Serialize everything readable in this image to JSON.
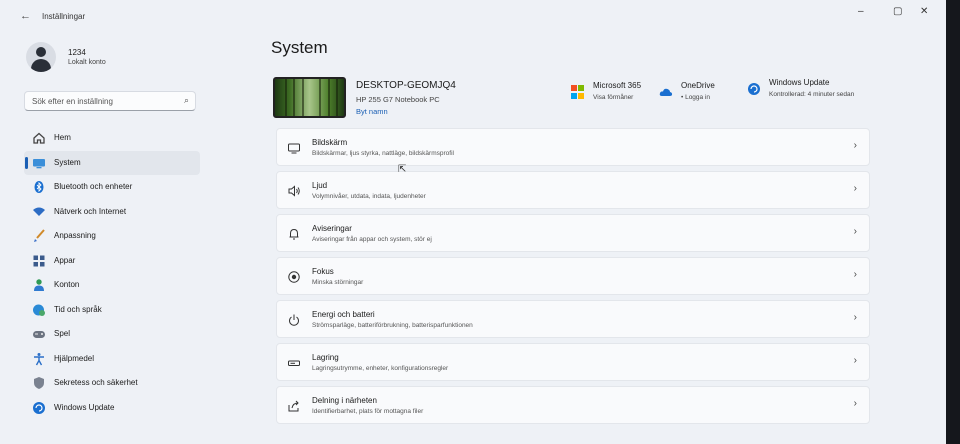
{
  "window": {
    "back_icon": "back-arrow-icon",
    "title": "Inställningar",
    "minimize": "–",
    "maximize": "▢",
    "close": "✕"
  },
  "profile": {
    "name": "1234",
    "type": "Lokalt konto"
  },
  "search": {
    "placeholder": "Sök efter en inställning",
    "icon": "search-icon"
  },
  "nav": [
    {
      "label": "Hem",
      "icon": "home-icon"
    },
    {
      "label": "System",
      "icon": "monitor-icon",
      "active": true
    },
    {
      "label": "Bluetooth och enheter",
      "icon": "bluetooth-icon"
    },
    {
      "label": "Nätverk och Internet",
      "icon": "wifi-icon"
    },
    {
      "label": "Anpassning",
      "icon": "brush-icon"
    },
    {
      "label": "Appar",
      "icon": "apps-icon"
    },
    {
      "label": "Konton",
      "icon": "person-icon"
    },
    {
      "label": "Tid och språk",
      "icon": "globe-clock-icon"
    },
    {
      "label": "Spel",
      "icon": "gamepad-icon"
    },
    {
      "label": "Hjälpmedel",
      "icon": "accessibility-icon"
    },
    {
      "label": "Sekretess och säkerhet",
      "icon": "shield-icon"
    },
    {
      "label": "Windows Update",
      "icon": "update-icon"
    }
  ],
  "main": {
    "title": "System",
    "device": {
      "name": "DESKTOP-GEOMJQ4",
      "model": "HP 255 G7 Notebook PC",
      "rename": "Byt namn"
    },
    "tiles": [
      {
        "title": "Microsoft 365",
        "sub": "Visa förmåner",
        "icon": "microsoft-365-icon"
      },
      {
        "title": "OneDrive",
        "sub": "• Logga in",
        "icon": "onedrive-cloud-icon"
      },
      {
        "title": "Windows Update",
        "sub": "Kontrollerad: 4 minuter sedan",
        "icon": "windows-update-icon"
      }
    ],
    "cards": [
      {
        "title": "Bildskärm",
        "sub": "Bildskärmar, ljus styrka, nattläge, bildskärmsprofil",
        "icon": "display-icon"
      },
      {
        "title": "Ljud",
        "sub": "Volymnivåer, utdata, indata, ljudenheter",
        "icon": "speaker-icon"
      },
      {
        "title": "Aviseringar",
        "sub": "Aviseringar från appar och system, stör ej",
        "icon": "bell-icon"
      },
      {
        "title": "Fokus",
        "sub": "Minska störningar",
        "icon": "focus-icon"
      },
      {
        "title": "Energi och batteri",
        "sub": "Strömsparläge, batteriförbrukning, batterisparfunktionen",
        "icon": "power-icon"
      },
      {
        "title": "Lagring",
        "sub": "Lagringsutrymme, enheter, konfigurationsregler",
        "icon": "storage-icon"
      },
      {
        "title": "Delning i närheten",
        "sub": "Identifierbarhet, plats för mottagna filer",
        "icon": "share-icon"
      }
    ]
  },
  "colors": {
    "accent": "#1a5fb4",
    "background": "#eef1f6",
    "card": "#f9fafc"
  }
}
